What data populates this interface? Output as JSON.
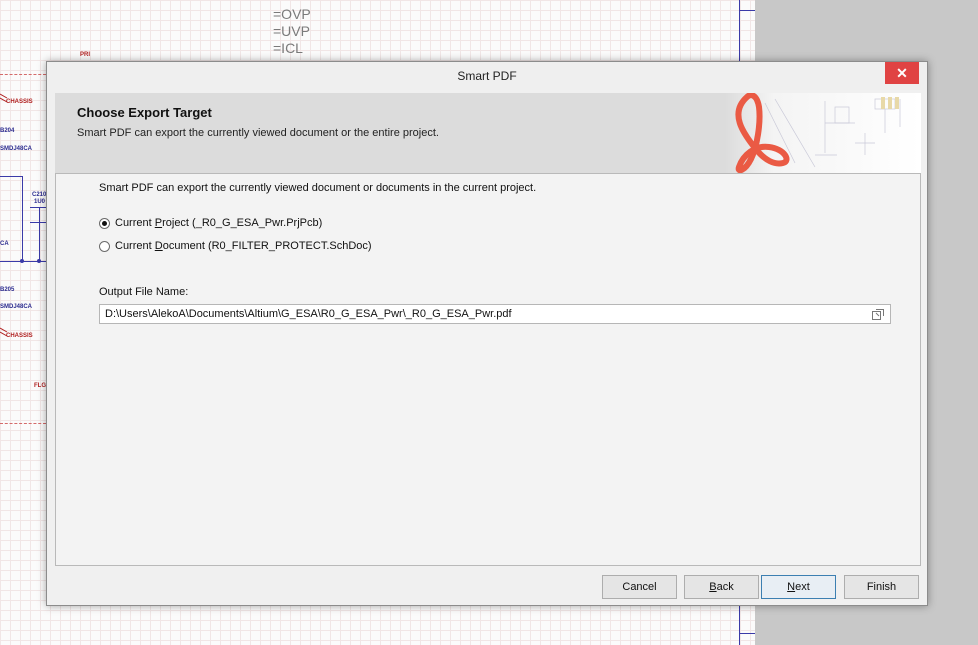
{
  "background": {
    "schematic_labels": [
      "=OVP",
      "=UVP",
      "=ICL"
    ],
    "schematic_small": [
      "PRI",
      "CHASSIS",
      "B204",
      "SMDJ48CA",
      "C210",
      "1U0",
      "CA",
      "B205",
      "SMDJ48CA",
      "CHASSIS",
      "FLG"
    ]
  },
  "dialog": {
    "title": "Smart PDF",
    "close_label": "✕",
    "header": {
      "title": "Choose Export Target",
      "subtitle": "Smart PDF can export the currently viewed document or the entire project."
    },
    "intro": "Smart PDF can export the currently viewed document or documents in the current project.",
    "options": [
      {
        "pre": "Current ",
        "accel": "P",
        "post": "roject (_R0_G_ESA_Pwr.PrjPcb)",
        "selected": true
      },
      {
        "pre": "Current ",
        "accel": "D",
        "post": "ocument (R0_FILTER_PROTECT.SchDoc)",
        "selected": false
      }
    ],
    "output_label": "Output File Name:",
    "output_value": "D:\\Users\\AlekoA\\Documents\\Altium\\G_ESA\\R0_G_ESA_Pwr\\_R0_G_ESA_Pwr.pdf",
    "buttons": {
      "cancel": "Cancel",
      "back_accel": "B",
      "back_rest": "ack",
      "next_accel": "N",
      "next_rest": "ext",
      "finish": "Finish"
    },
    "accent_color": "#e04343"
  }
}
